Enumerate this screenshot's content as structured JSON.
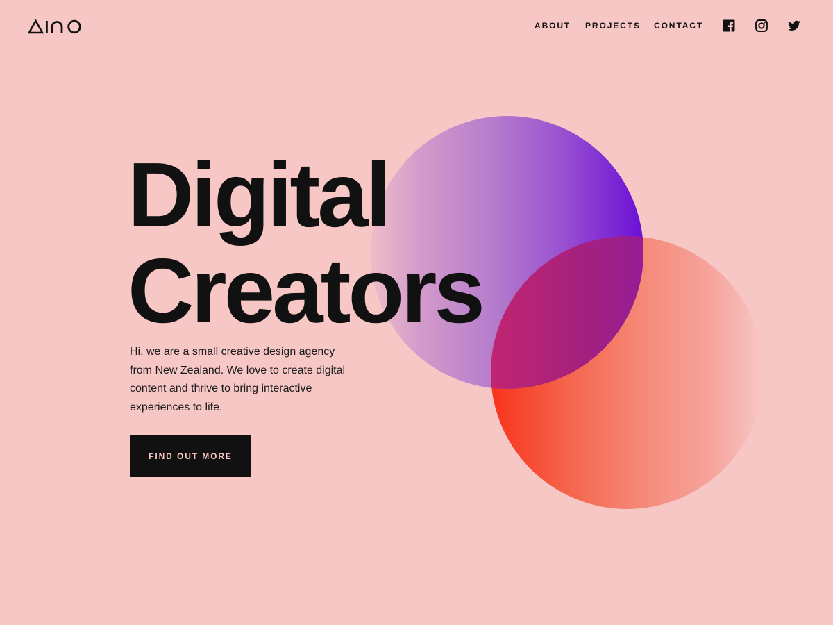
{
  "brand": {
    "logo_text": "AINO"
  },
  "nav": {
    "items": [
      {
        "label": "ABOUT"
      },
      {
        "label": "PROJECTS"
      },
      {
        "label": "CONTACT"
      }
    ]
  },
  "social": {
    "icons": [
      "facebook-icon",
      "instagram-icon",
      "twitter-icon"
    ]
  },
  "hero": {
    "title_line1": "Digital",
    "title_line2": "Creators",
    "intro": "Hi, we are a small creative design agency from New Zealand. We love to create digital content and thrive to bring interactive experiences to life.",
    "cta_label": "FIND OUT MORE"
  },
  "colors": {
    "background": "#f7c7c5",
    "text": "#111111",
    "button_bg": "#111111",
    "button_text": "#f7c7c5",
    "purple_circle_end": "#6b0fd6",
    "orange_circle_start": "#f8331c"
  }
}
